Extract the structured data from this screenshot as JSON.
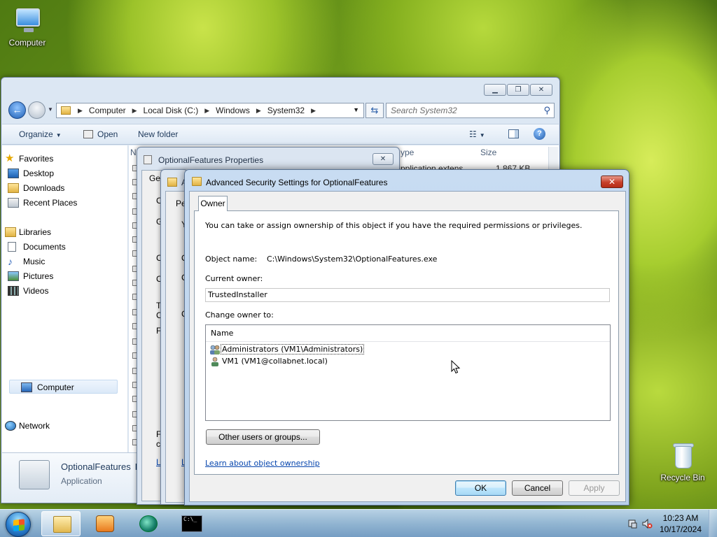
{
  "desktop": {
    "icons": [
      {
        "label": "Computer"
      },
      {
        "label": "Recycle Bin"
      }
    ]
  },
  "explorer": {
    "breadcrumb": [
      "Computer",
      "Local Disk (C:)",
      "Windows",
      "System32"
    ],
    "search_placeholder": "Search System32",
    "toolbar": {
      "organize": "Organize",
      "open": "Open",
      "new_folder": "New folder"
    },
    "nav": {
      "favorites": "Favorites",
      "desktop": "Desktop",
      "downloads": "Downloads",
      "recent": "Recent Places",
      "libraries": "Libraries",
      "documents": "Documents",
      "music": "Music",
      "pictures": "Pictures",
      "videos": "Videos",
      "computer": "Computer",
      "network": "Network"
    },
    "columns": {
      "name": "N",
      "type": "ype",
      "size": "Size"
    },
    "first_row": {
      "type": "pplication extens",
      "size": "1,867 KB"
    },
    "details": {
      "name": "OptionalFeatures",
      "name_trail": "D",
      "type": "Application"
    }
  },
  "props_dialog": {
    "title": "OptionalFeatures Properties",
    "tab_fragment": "Ge",
    "fragments": [
      "C",
      "G",
      "C",
      "C",
      "T",
      "C",
      "F",
      "F",
      "c",
      "L"
    ]
  },
  "perm_dialog": {
    "title_fragment": "A",
    "tab_fragment": "Pe",
    "fragments": [
      "Y",
      "O",
      "C",
      "C",
      "L"
    ]
  },
  "advanced": {
    "title": "Advanced Security Settings for OptionalFeatures",
    "close_glyph": "✕",
    "tab": "Owner",
    "intro": "You can take or assign ownership of this object if you have the required permissions or privileges.",
    "object_label": "Object name:",
    "object_value": "C:\\Windows\\System32\\OptionalFeatures.exe",
    "current_owner_label": "Current owner:",
    "current_owner_value": "TrustedInstaller",
    "change_owner_label": "Change owner to:",
    "list_header": "Name",
    "owners": [
      {
        "name": "Administrators (VM1\\Administrators)"
      },
      {
        "name": "VM1 (VM1@collabnet.local)"
      }
    ],
    "other_users_button": "Other users or groups...",
    "learn_link": "Learn about object ownership",
    "ok": "OK",
    "cancel": "Cancel",
    "apply": "Apply"
  },
  "taskbar": {
    "time": "10:23 AM",
    "date": "10/17/2024",
    "cmd_glyph": "C:\\_"
  },
  "colors": {
    "accent": "#3c7fb1",
    "close_red": "#c7402b",
    "link": "#0645ad"
  }
}
